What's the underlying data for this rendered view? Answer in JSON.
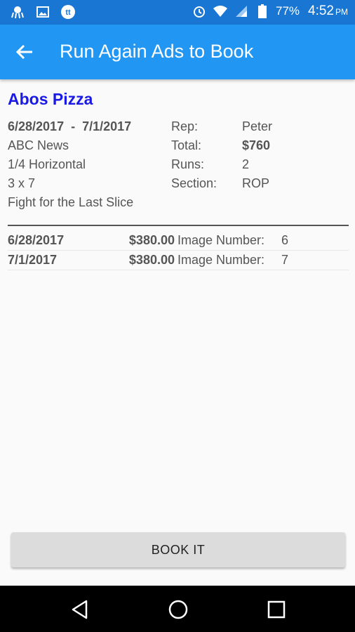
{
  "status_bar": {
    "icons_left": [
      "octopus-icon",
      "image-icon",
      "tt-icon"
    ],
    "alarm_icon": "alarm-icon",
    "wifi_icon": "wifi-icon",
    "signal_icon": "signal-icon",
    "battery_icon": "battery-icon",
    "battery_percent": "77%",
    "time": "4:52",
    "ampm": "PM",
    "background": "#1976d2"
  },
  "app_bar": {
    "title": "Run Again Ads to Book",
    "back_icon": "back-arrow-icon",
    "background": "#2196f3"
  },
  "ad": {
    "title": "Abos Pizza",
    "title_color": "#1a1ae6",
    "date_start": "6/28/2017",
    "date_sep": "-",
    "date_end": "7/1/2017",
    "publication": "ABC News",
    "size": "1/4 Horizontal",
    "dimensions": "3 x 7",
    "headline": "Fight for the Last Slice",
    "rep_label": "Rep:",
    "rep_value": "Peter",
    "total_label": "Total:",
    "total_value": "$760",
    "runs_label": "Runs:",
    "runs_value": "2",
    "section_label": "Section:",
    "section_value": "ROP"
  },
  "runs": [
    {
      "date": "6/28/2017",
      "amount": "$380.00",
      "label": "Image Number:",
      "number": "6"
    },
    {
      "date": "7/1/2017",
      "amount": "$380.00",
      "label": "Image Number:",
      "number": "7"
    }
  ],
  "book_button": {
    "label": "BOOK IT"
  },
  "nav_bar": {
    "back": "nav-back-icon",
    "home": "nav-home-icon",
    "recents": "nav-recents-icon"
  }
}
